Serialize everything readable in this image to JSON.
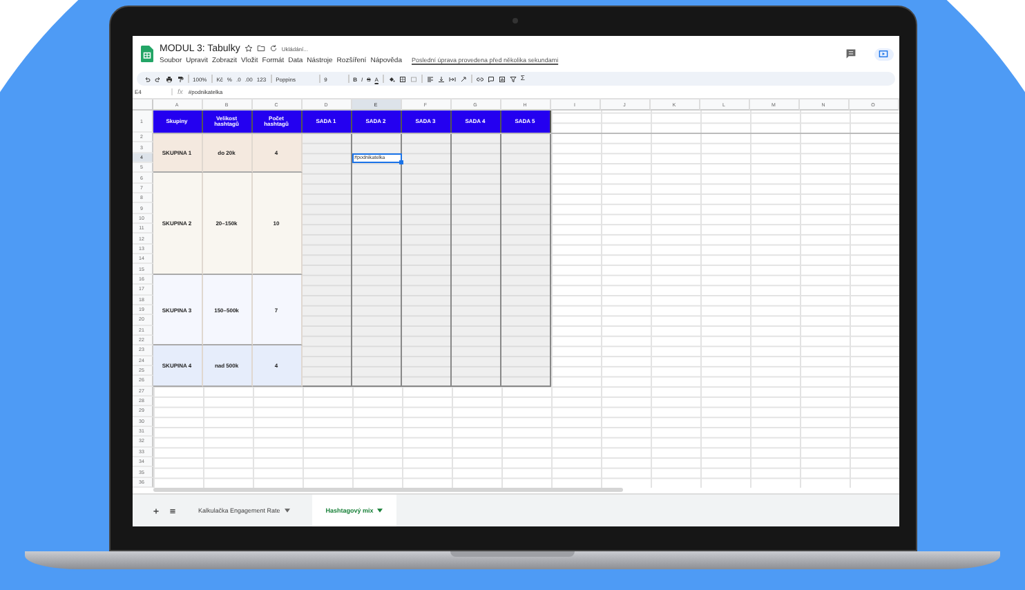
{
  "app": {
    "title": "MODUL 3: Tabulky",
    "status": "Ukládání...",
    "menu": [
      "Soubor",
      "Upravit",
      "Zobrazit",
      "Vložit",
      "Formát",
      "Data",
      "Nástroje",
      "Rozšíření",
      "Nápověda"
    ],
    "last_edit": "Poslední úprava provedena před několika sekundami"
  },
  "toolbar": {
    "zoom": "100%",
    "currency": "Kč",
    "percent": "%",
    "decimals_less": ".0",
    "decimals_more": ".00",
    "format": "123",
    "font": "Poppins",
    "font_size": "9",
    "bold": "B",
    "italic": "I",
    "strike": "S",
    "text_color": "A",
    "function": "Σ"
  },
  "formula_bar": {
    "cell": "E4",
    "fx": "fx",
    "value": "#podnikatelka"
  },
  "sheet": {
    "columns": [
      {
        "label": "A",
        "selected": false
      },
      {
        "label": "B",
        "selected": false
      },
      {
        "label": "C",
        "selected": false
      },
      {
        "label": "D",
        "selected": false
      },
      {
        "label": "E",
        "selected": true
      },
      {
        "label": "F",
        "selected": false
      },
      {
        "label": "G",
        "selected": false
      },
      {
        "label": "H",
        "selected": false
      },
      {
        "label": "I",
        "selected": false
      },
      {
        "label": "J",
        "selected": false
      },
      {
        "label": "K",
        "selected": false
      },
      {
        "label": "L",
        "selected": false
      },
      {
        "label": "M",
        "selected": false
      },
      {
        "label": "N",
        "selected": false
      },
      {
        "label": "O",
        "selected": false
      }
    ],
    "rows": [
      {
        "label": "1",
        "selected": false
      },
      {
        "label": "2",
        "selected": false
      },
      {
        "label": "3",
        "selected": false
      },
      {
        "label": "4",
        "selected": true
      },
      {
        "label": "5",
        "selected": false
      },
      {
        "label": "6",
        "selected": false
      },
      {
        "label": "7",
        "selected": false
      },
      {
        "label": "8",
        "selected": false
      },
      {
        "label": "9",
        "selected": false
      },
      {
        "label": "10",
        "selected": false
      },
      {
        "label": "11",
        "selected": false
      },
      {
        "label": "12",
        "selected": false
      },
      {
        "label": "13",
        "selected": false
      },
      {
        "label": "14",
        "selected": false
      },
      {
        "label": "15",
        "selected": false
      },
      {
        "label": "16",
        "selected": false
      },
      {
        "label": "17",
        "selected": false
      },
      {
        "label": "18",
        "selected": false
      },
      {
        "label": "19",
        "selected": false
      },
      {
        "label": "20",
        "selected": false
      },
      {
        "label": "21",
        "selected": false
      },
      {
        "label": "22",
        "selected": false
      },
      {
        "label": "23",
        "selected": false
      },
      {
        "label": "24",
        "selected": false
      },
      {
        "label": "25",
        "selected": false
      },
      {
        "label": "26",
        "selected": false
      },
      {
        "label": "27",
        "selected": false
      },
      {
        "label": "28",
        "selected": false
      },
      {
        "label": "29",
        "selected": false
      },
      {
        "label": "30",
        "selected": false
      },
      {
        "label": "31",
        "selected": false
      },
      {
        "label": "32",
        "selected": false
      },
      {
        "label": "33",
        "selected": false
      },
      {
        "label": "34",
        "selected": false
      },
      {
        "label": "35",
        "selected": false
      },
      {
        "label": "36",
        "selected": false
      }
    ],
    "header": [
      "Skupiny",
      "Velikost hashtagů",
      "Počet hashtagů",
      "SADA 1",
      "SADA 2",
      "SADA 3",
      "SADA 4",
      "SADA 5"
    ],
    "groups": [
      {
        "name": "SKUPINA 1",
        "size": "do 20k",
        "count": "4",
        "color": "#f4e9df"
      },
      {
        "name": "SKUPINA 2",
        "size": "20–150k",
        "count": "10",
        "color": "#f9f6f0"
      },
      {
        "name": "SKUPINA 3",
        "size": "150–500k",
        "count": "7",
        "color": "#f5f7fe"
      },
      {
        "name": "SKUPINA 4",
        "size": "nad 500k",
        "count": "4",
        "color": "#e6edfb"
      }
    ],
    "active_cell": "#podnikatelka"
  },
  "sheet_tabs": [
    {
      "label": "Kalkulačka Engagement Rate",
      "selected": false
    },
    {
      "label": "Hashtagový mix",
      "selected": true
    }
  ]
}
